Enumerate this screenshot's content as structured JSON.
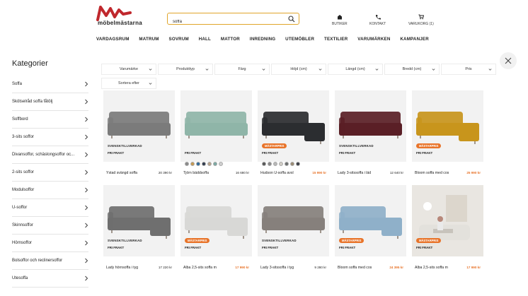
{
  "brand": {
    "name": "möbelmästarna",
    "logo_color": "#c0282d"
  },
  "search": {
    "value": "soffa",
    "placeholder": "",
    "accent": "#e0a52a"
  },
  "header_links": [
    {
      "label": "BUTIKER",
      "icon": "store-icon"
    },
    {
      "label": "KONTAKT",
      "icon": "phone-icon"
    },
    {
      "label": "VARUKORG (1)",
      "icon": "cart-icon"
    }
  ],
  "nav": [
    "VARDAGSRUM",
    "MATRUM",
    "SOVRUM",
    "HALL",
    "MATTOR",
    "INREDNING",
    "UTEMÖBLER",
    "TEXTILIER",
    "VARUMÄRKEN",
    "KAMPANJER"
  ],
  "sidebar": {
    "title": "Kategorier",
    "items": [
      "Soffa",
      "Skötselråd soffa fåtölj",
      "Soffbord",
      "3-sits soffor",
      "Divansoffor, schäslongsoffor oc...",
      "2-sits soffor",
      "Modulsoffor",
      "U-soffor",
      "Skinnsoffor",
      "Hörnsoffor",
      "Bolsoffor och reclinersoffor",
      "Utesoffa"
    ]
  },
  "filters": [
    "Varumärke",
    "Produkttyp",
    "Färg",
    "Höjd (cm)",
    "Längd (cm)",
    "Bredd (cm)",
    "Pris",
    "Sortera efter"
  ],
  "colors": {
    "accent_orange": "#e8742a",
    "image_bg": "#f2f2f2"
  },
  "products": [
    {
      "name": "Ystad svängd soffa",
      "price": "20 390 kr",
      "badge": "SVENSKTILLVERKAD",
      "badge_type": "gray",
      "frakt": "FRI FRAKT",
      "sale": false,
      "sofa_color": "#7b7b7b"
    },
    {
      "name": "Tjörn bäddsoffa",
      "price": "16 680 kr",
      "badge": "",
      "badge_type": "",
      "frakt": "FRI FRAKT",
      "sale": false,
      "sofa_color": "#8fb5a8",
      "swatches": [
        "#8a8a8a",
        "#c69a52",
        "#2e6a9a",
        "#303b4d",
        "#b9a48a",
        "#7ba9a3",
        "#cfcfcf"
      ]
    },
    {
      "name": "Hudson U-soffa avsl",
      "price": "15 990 kr",
      "old_price": "",
      "badge": "MÄSTARPRIS",
      "badge_type": "orange",
      "frakt": "FRI FRAKT",
      "sale": true,
      "sofa_color": "#2b2d30",
      "swatches": [
        "#555",
        "#8a8a8a",
        "#b7b7b7",
        "#d2cec6",
        "#6c6f6f",
        "#9b8b74",
        "#3a3d45"
      ]
    },
    {
      "name": "Lady 3-sitssoffa i läd",
      "price": "12 640 kr",
      "badge": "SVENSKTILLVERKAD",
      "badge_type": "gray",
      "frakt": "FRI FRAKT",
      "sale": false,
      "sofa_color": "#5a1f26"
    },
    {
      "name": "Bloom soffa med cos",
      "price": "25 990 kr",
      "old_price": "",
      "badge": "MÄSTARPRIS",
      "badge_type": "orange",
      "frakt": "FRI FRAKT",
      "sale": true,
      "sofa_color": "#c8951c"
    },
    {
      "name": "Lady hörnsoffa i tyg",
      "price": "17 220 kr",
      "badge": "SVENSKTILLVERKAD",
      "badge_type": "gray",
      "frakt": "FRI FRAKT",
      "sale": false,
      "sofa_color": "#6f6f6f"
    },
    {
      "name": "Alba 2,5-sits soffa m",
      "price": "17 990 kr",
      "old_price": "",
      "badge": "MÄSTARPRIS",
      "badge_type": "orange",
      "frakt": "FRI FRAKT",
      "sale": true,
      "sofa_color": "#d8d8d6"
    },
    {
      "name": "Lady 3-sitssoffa i tyg",
      "price": "9 280 kr",
      "badge": "SVENSKTILLVERKAD",
      "badge_type": "gray",
      "frakt": "FRI FRAKT",
      "sale": false,
      "sofa_color": "#86807c"
    },
    {
      "name": "Bloom soffa med cos",
      "price": "24 395 kr",
      "old_price": "",
      "badge": "MÄSTARPRIS",
      "badge_type": "orange",
      "frakt": "FRI FRAKT",
      "sale": true,
      "sofa_color": "#8fb0c9"
    },
    {
      "name": "Alba 2,5-sits soffa m",
      "price": "17 990 kr",
      "old_price": "",
      "badge": "MÄSTARPRIS",
      "badge_type": "orange",
      "frakt": "FRI FRAKT",
      "sale": true,
      "sofa_color": "#e3e1dc"
    }
  ]
}
